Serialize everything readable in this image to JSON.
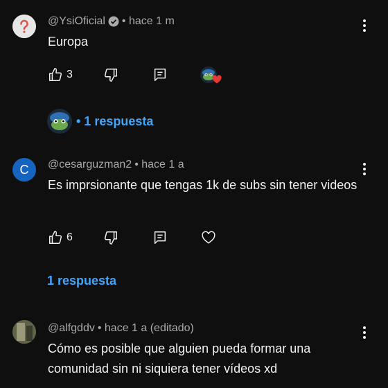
{
  "comments": [
    {
      "author": "@YsiOficial",
      "verified": true,
      "time": "• hace 1 m",
      "text": "Europa",
      "likes": "3",
      "avatar_icon": "question-mark-icon",
      "replies_label": "• 1 respuesta",
      "creator_heart": true
    },
    {
      "author": "@cesarguzman2",
      "time": "• hace 1 a",
      "text": "Es imprsionante que tengas 1k de subs sin tener videos",
      "likes": "6",
      "avatar_letter": "C",
      "replies_label": "1 respuesta"
    },
    {
      "author": "@alfgddv",
      "time": "• hace 1 a (editado)",
      "text": "Cómo es posible que alguien pueda formar una comunidad sin ni siquiera tener vídeos xd"
    }
  ],
  "colors": {
    "background": "#0f0f0f",
    "link_blue": "#3ea6ff",
    "secondary_text": "#aaaaaa",
    "avatar_c": "#1565c0",
    "heart": "#e53935"
  }
}
